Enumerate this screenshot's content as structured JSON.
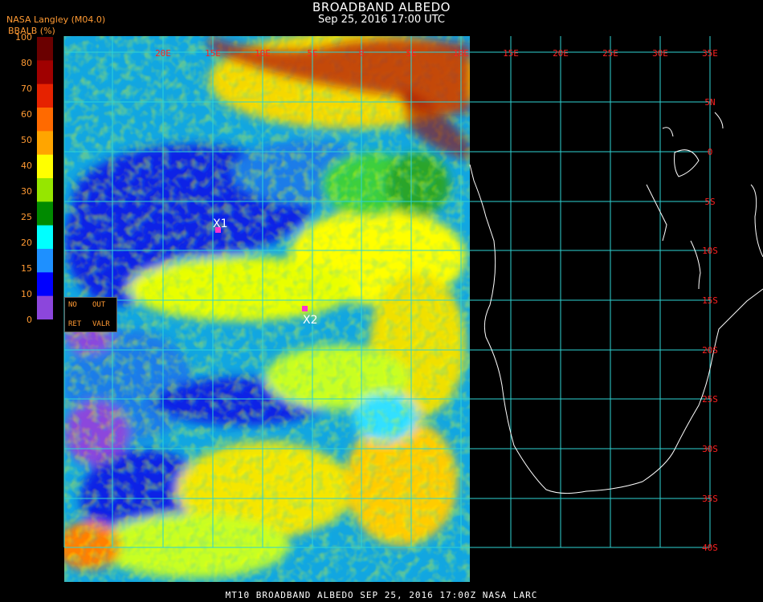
{
  "header": {
    "title": "BROADBAND ALBEDO",
    "subtitle": "Sep 25, 2016 17:00 UTC",
    "agency": "NASA Langley (M04.0)",
    "variable": "BBALB (%)"
  },
  "colorbar": {
    "ticks": [
      "100",
      "80",
      "70",
      "60",
      "50",
      "40",
      "30",
      "25",
      "20",
      "15",
      "10",
      "0"
    ],
    "colors": [
      "#6a0000",
      "#a00000",
      "#e62200",
      "#ff6a00",
      "#ffa500",
      "#ffff00",
      "#96e600",
      "#008a00",
      "#00ffff",
      "#1e90ff",
      "#0000ff",
      "#8c46dc"
    ]
  },
  "grid": {
    "lon_labels": [
      "20E",
      "15E",
      "10E",
      "5E",
      "0",
      "5E",
      "10E",
      "15E",
      "20E",
      "25E",
      "30E",
      "35E"
    ],
    "lat_labels": [
      "5N",
      "0",
      "5S",
      "10S",
      "15S",
      "20S",
      "25S",
      "30S",
      "35S",
      "40S"
    ],
    "line_color": "#2fd3d3",
    "label_color": "#ff2020"
  },
  "markers": [
    {
      "label": "X1"
    },
    {
      "label": "X2"
    }
  ],
  "keybox": {
    "no": "NO",
    "out": "OUT",
    "ret": "RET",
    "valr": "VALR"
  },
  "footer": "MT10  BROADBAND ALBEDO   SEP 25, 2016 17:00Z   NASA LARC"
}
